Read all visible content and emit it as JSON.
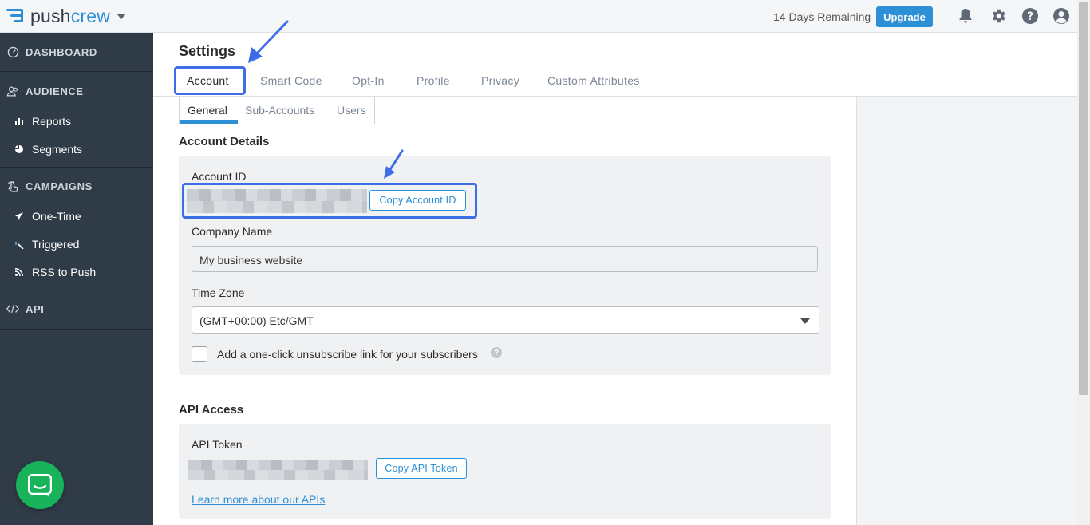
{
  "brand": {
    "name_prefix": "push",
    "name_suffix": "crew",
    "color": "#2d8fd6"
  },
  "topbar": {
    "trial_text": "14 Days Remaining",
    "upgrade_label": "Upgrade",
    "icons": [
      "bell-icon",
      "gear-icon",
      "help-icon",
      "user-icon"
    ]
  },
  "sidebar": {
    "sections": [
      {
        "label": "DASHBOARD",
        "icon": "dashboard-icon"
      },
      {
        "label": "AUDIENCE",
        "icon": "people-icon"
      },
      {
        "label": "CAMPAIGNS",
        "icon": "pointer-icon"
      },
      {
        "label": "API",
        "icon": "code-icon"
      }
    ],
    "audience_items": [
      {
        "label": "Reports",
        "icon": "bar-chart-icon"
      },
      {
        "label": "Segments",
        "icon": "pie-chart-icon"
      }
    ],
    "campaign_items": [
      {
        "label": "One-Time",
        "icon": "paper-plane-icon"
      },
      {
        "label": "Triggered",
        "icon": "magic-icon"
      },
      {
        "label": "RSS to Push",
        "icon": "rss-icon"
      }
    ]
  },
  "page": {
    "title": "Settings",
    "tabs": [
      "Account",
      "Smart Code",
      "Opt-In",
      "Profile",
      "Privacy",
      "Custom Attributes"
    ],
    "active_tab": "Account",
    "subtabs": [
      "General",
      "Sub-Accounts",
      "Users"
    ],
    "active_subtab": "General"
  },
  "account_details": {
    "heading": "Account Details",
    "account_id_label": "Account ID",
    "copy_account_id_label": "Copy Account ID",
    "company_name_label": "Company Name",
    "company_name_value": "My business website",
    "time_zone_label": "Time Zone",
    "time_zone_value": "(GMT+00:00) Etc/GMT",
    "unsubscribe_label": "Add a one-click unsubscribe link for your subscribers",
    "unsubscribe_checked": false
  },
  "api_access": {
    "heading": "API Access",
    "token_label": "API Token",
    "copy_token_label": "Copy API Token",
    "learn_more_link": "Learn more about our APIs"
  },
  "colors": {
    "sidebar_bg": "#2f3b47",
    "accent": "#2d8fd6",
    "annotation": "#3d6ee6",
    "chat": "#19b35b"
  }
}
